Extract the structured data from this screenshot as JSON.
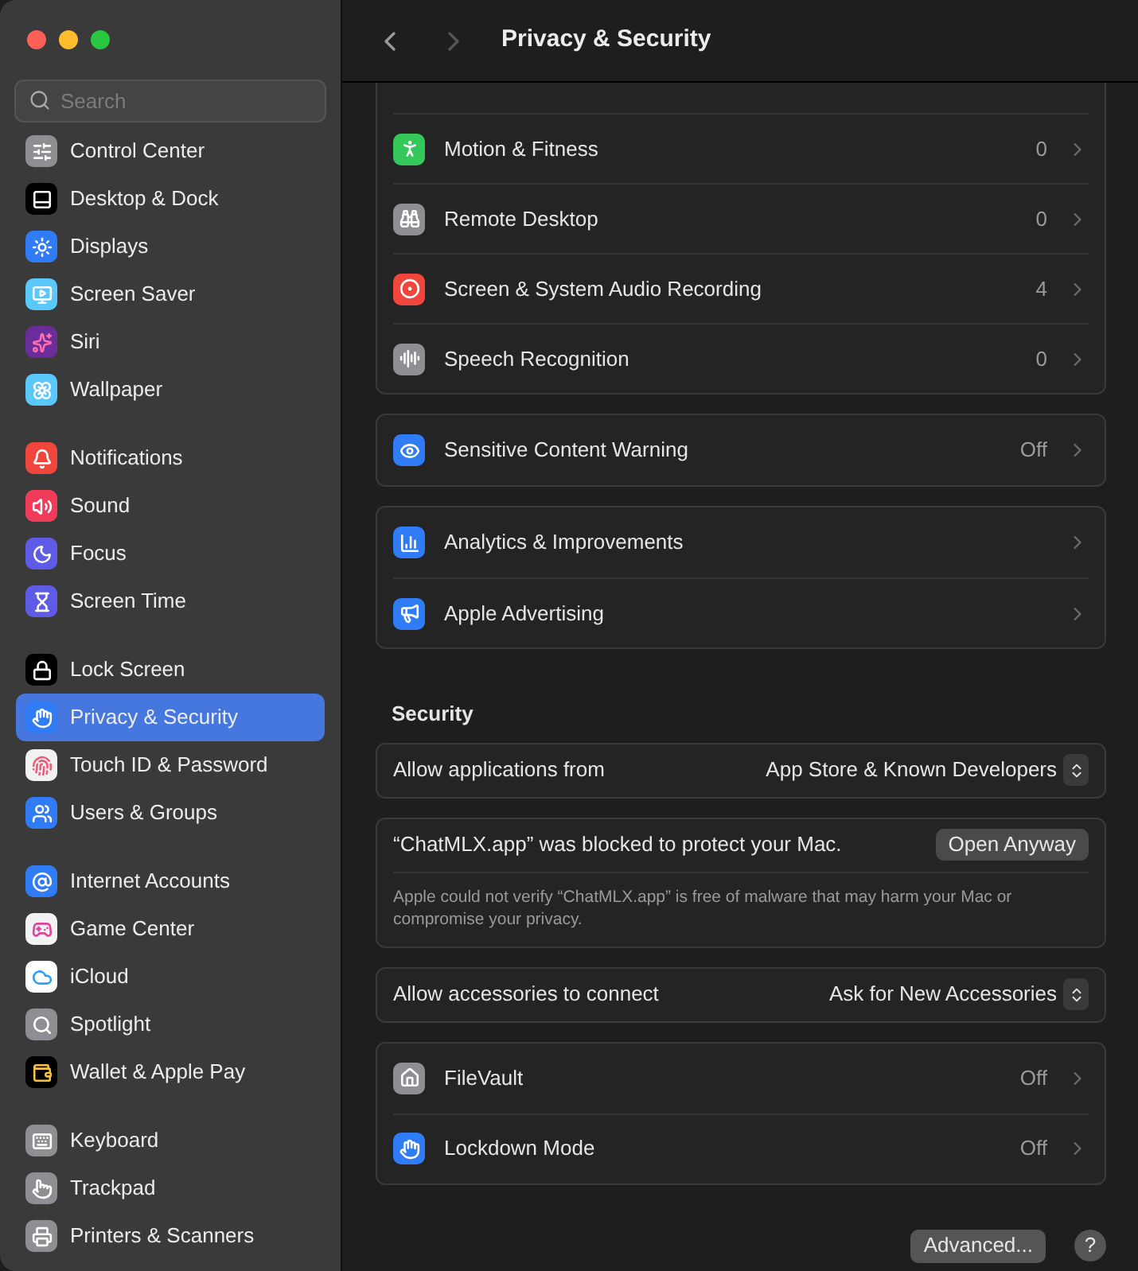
{
  "sidebar": {
    "search": {
      "placeholder": "Search"
    },
    "groups": [
      {
        "items": [
          {
            "label": "Control Center",
            "selected": false
          },
          {
            "label": "Desktop & Dock",
            "selected": false
          },
          {
            "label": "Displays",
            "selected": false
          },
          {
            "label": "Screen Saver",
            "selected": false
          },
          {
            "label": "Siri",
            "selected": false
          },
          {
            "label": "Wallpaper",
            "selected": false
          }
        ]
      },
      {
        "items": [
          {
            "label": "Notifications",
            "selected": false
          },
          {
            "label": "Sound",
            "selected": false
          },
          {
            "label": "Focus",
            "selected": false
          },
          {
            "label": "Screen Time",
            "selected": false
          }
        ]
      },
      {
        "items": [
          {
            "label": "Lock Screen",
            "selected": false
          },
          {
            "label": "Privacy & Security",
            "selected": true
          },
          {
            "label": "Touch ID & Password",
            "selected": false
          },
          {
            "label": "Users & Groups",
            "selected": false
          }
        ]
      },
      {
        "items": [
          {
            "label": "Internet Accounts",
            "selected": false
          },
          {
            "label": "Game Center",
            "selected": false
          },
          {
            "label": "iCloud",
            "selected": false
          },
          {
            "label": "Spotlight",
            "selected": false
          },
          {
            "label": "Wallet & Apple Pay",
            "selected": false
          }
        ]
      },
      {
        "items": [
          {
            "label": "Keyboard",
            "selected": false
          },
          {
            "label": "Trackpad",
            "selected": false
          },
          {
            "label": "Printers & Scanners",
            "selected": false
          }
        ]
      }
    ]
  },
  "header": {
    "title": "Privacy & Security"
  },
  "cards": [
    {
      "rows": [
        {
          "label": "Motion & Fitness",
          "value": "0"
        },
        {
          "label": "Remote Desktop",
          "value": "0"
        },
        {
          "label": "Screen & System Audio Recording",
          "value": "4"
        },
        {
          "label": "Speech Recognition",
          "value": "0"
        }
      ]
    },
    {
      "rows": [
        {
          "label": "Sensitive Content Warning",
          "value": "Off"
        }
      ]
    },
    {
      "rows": [
        {
          "label": "Analytics & Improvements"
        },
        {
          "label": "Apple Advertising"
        }
      ]
    }
  ],
  "security": {
    "heading": "Security",
    "allow_apps": {
      "label": "Allow applications from",
      "value": "App Store & Known Developers"
    },
    "blocked": {
      "message": "“ChatMLX.app” was blocked to protect your Mac.",
      "button": "Open Anyway",
      "note": "Apple could not verify “ChatMLX.app” is free of malware that may harm your Mac or compromise your privacy."
    },
    "accessories": {
      "label": "Allow accessories to connect",
      "value": "Ask for New Accessories"
    },
    "rows": [
      {
        "label": "FileVault",
        "value": "Off"
      },
      {
        "label": "Lockdown Mode",
        "value": "Off"
      }
    ]
  },
  "footer": {
    "advanced_button": "Advanced...",
    "help_button": "?"
  }
}
